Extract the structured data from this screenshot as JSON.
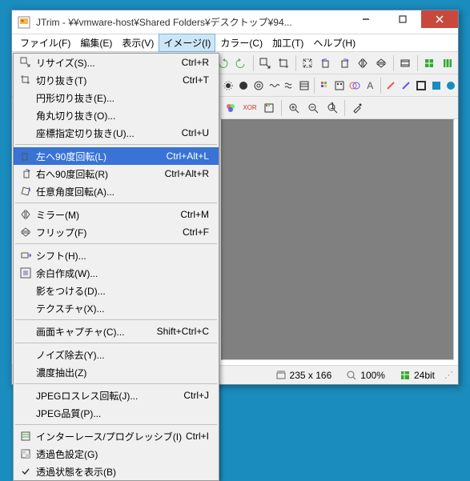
{
  "title": "JTrim - ¥¥vmware-host¥Shared Folders¥デスクトップ¥94...",
  "menubar": [
    "ファイル(F)",
    "編集(E)",
    "表示(V)",
    "イメージ(I)",
    "カラー(C)",
    "加工(T)",
    "ヘルプ(H)"
  ],
  "menubar_open_index": 3,
  "dropdown": [
    {
      "icon": "resize",
      "label": "リサイズ(S)...",
      "shortcut": "Ctrl+R"
    },
    {
      "icon": "crop",
      "label": "切り抜き(T)",
      "shortcut": "Ctrl+T"
    },
    {
      "icon": "",
      "label": "円形切り抜き(E)...",
      "shortcut": ""
    },
    {
      "icon": "",
      "label": "角丸切り抜き(O)...",
      "shortcut": ""
    },
    {
      "icon": "",
      "label": "座標指定切り抜き(U)...",
      "shortcut": "Ctrl+U"
    },
    {
      "sep": true
    },
    {
      "icon": "rot90l",
      "label": "左へ90度回転(L)",
      "shortcut": "Ctrl+Alt+L",
      "selected": true
    },
    {
      "icon": "rot90r",
      "label": "右へ90度回転(R)",
      "shortcut": "Ctrl+Alt+R"
    },
    {
      "icon": "rotfree",
      "label": "任意角度回転(A)...",
      "shortcut": ""
    },
    {
      "sep": true
    },
    {
      "icon": "mirror",
      "label": "ミラー(M)",
      "shortcut": "Ctrl+M"
    },
    {
      "icon": "flip",
      "label": "フリップ(F)",
      "shortcut": "Ctrl+F"
    },
    {
      "sep": true
    },
    {
      "icon": "shift",
      "label": "シフト(H)...",
      "shortcut": ""
    },
    {
      "icon": "margin",
      "label": "余白作成(W)...",
      "shortcut": ""
    },
    {
      "icon": "",
      "label": "影をつける(D)...",
      "shortcut": ""
    },
    {
      "icon": "",
      "label": "テクスチャ(X)...",
      "shortcut": ""
    },
    {
      "sep": true
    },
    {
      "icon": "",
      "label": "画面キャプチャ(C)...",
      "shortcut": "Shift+Ctrl+C"
    },
    {
      "sep": true
    },
    {
      "icon": "",
      "label": "ノイズ除去(Y)...",
      "shortcut": ""
    },
    {
      "icon": "",
      "label": "濃度抽出(Z)",
      "shortcut": ""
    },
    {
      "sep": true
    },
    {
      "icon": "",
      "label": "JPEGロスレス回転(J)...",
      "shortcut": "Ctrl+J"
    },
    {
      "icon": "",
      "label": "JPEG品質(P)...",
      "shortcut": ""
    },
    {
      "sep": true
    },
    {
      "icon": "interlace",
      "label": "インターレース/プログレッシブ(I)",
      "shortcut": "Ctrl+I"
    },
    {
      "icon": "transcolor",
      "label": "透過色設定(G)",
      "shortcut": ""
    },
    {
      "icon": "check",
      "label": "透過状態を表示(B)",
      "shortcut": ""
    }
  ],
  "statusbar": {
    "dim": "235 x 166",
    "zoom": "100%",
    "depth": "24bit"
  }
}
